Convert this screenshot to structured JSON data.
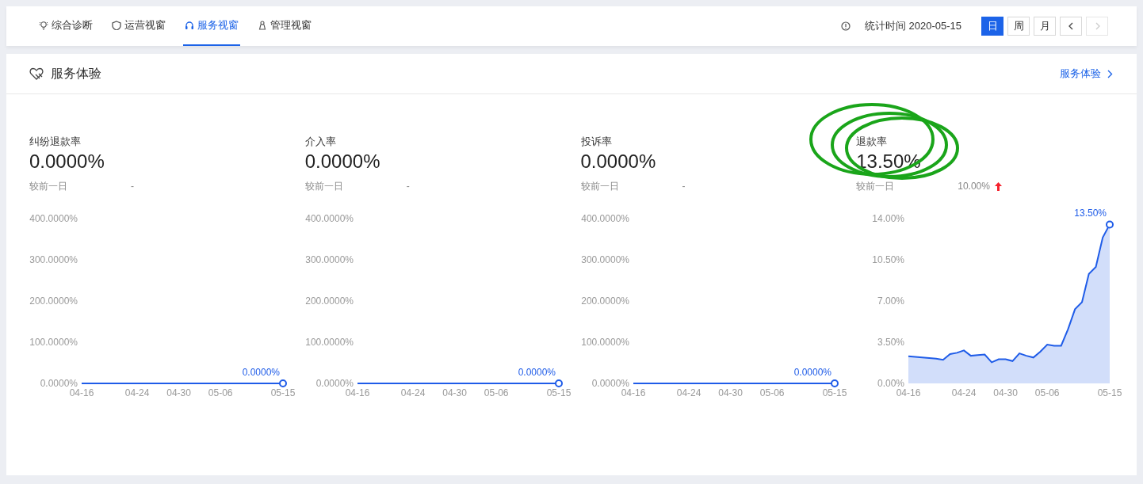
{
  "nav": {
    "tabs": [
      {
        "label": "综合诊断",
        "selected": false
      },
      {
        "label": "运营视窗",
        "selected": false
      },
      {
        "label": "服务视窗",
        "selected": true
      },
      {
        "label": "管理视窗",
        "selected": false
      }
    ],
    "stat_time": "统计时间 2020-05-15",
    "period_buttons": [
      {
        "label": "日",
        "selected": true
      },
      {
        "label": "周",
        "selected": false
      },
      {
        "label": "月",
        "selected": false
      }
    ],
    "pager": [
      {
        "kind": "prev",
        "disabled": false
      },
      {
        "kind": "next",
        "disabled": true
      }
    ]
  },
  "section": {
    "title": "服务体验",
    "link": "服务体验"
  },
  "metrics": [
    {
      "title": "纠纷退款率",
      "value": "0.0000%",
      "compare_label": "较前一日",
      "compare_value": "-",
      "chart_data": {
        "type": "line",
        "categories": [
          "04-16",
          null,
          null,
          null,
          null,
          null,
          null,
          null,
          "04-24",
          null,
          null,
          null,
          null,
          null,
          "04-30",
          null,
          null,
          null,
          null,
          null,
          "05-06",
          null,
          null,
          null,
          null,
          null,
          null,
          null,
          null,
          "05-15"
        ],
        "series": [
          {
            "color": "#1f5ce8",
            "values": [
              0,
              0,
              0,
              0,
              0,
              0,
              0,
              0,
              0,
              0,
              0,
              0,
              0,
              0,
              0,
              0,
              0,
              0,
              0,
              0,
              0,
              0,
              0,
              0,
              0,
              0,
              0,
              0,
              0,
              0
            ]
          }
        ],
        "ylim": [
          0,
          400
        ],
        "yticks": [
          {
            "value": 0,
            "label": "0.0000%"
          },
          {
            "value": 100,
            "label": "100.0000%"
          },
          {
            "value": 200,
            "label": "200.0000%"
          },
          {
            "value": 300,
            "label": "300.0000%"
          },
          {
            "value": 400,
            "label": "400.0000%"
          }
        ],
        "annotations": [
          "0.0000%"
        ]
      }
    },
    {
      "title": "介入率",
      "value": "0.0000%",
      "compare_label": "较前一日",
      "compare_value": "-",
      "chart_data": {
        "type": "line",
        "categories": [
          "04-16",
          null,
          null,
          null,
          null,
          null,
          null,
          null,
          "04-24",
          null,
          null,
          null,
          null,
          null,
          "04-30",
          null,
          null,
          null,
          null,
          null,
          "05-06",
          null,
          null,
          null,
          null,
          null,
          null,
          null,
          null,
          "05-15"
        ],
        "series": [
          {
            "color": "#1f5ce8",
            "values": [
              0,
              0,
              0,
              0,
              0,
              0,
              0,
              0,
              0,
              0,
              0,
              0,
              0,
              0,
              0,
              0,
              0,
              0,
              0,
              0,
              0,
              0,
              0,
              0,
              0,
              0,
              0,
              0,
              0,
              0
            ]
          }
        ],
        "ylim": [
          0,
          400
        ],
        "yticks": [
          {
            "value": 0,
            "label": "0.0000%"
          },
          {
            "value": 100,
            "label": "100.0000%"
          },
          {
            "value": 200,
            "label": "200.0000%"
          },
          {
            "value": 300,
            "label": "300.0000%"
          },
          {
            "value": 400,
            "label": "400.0000%"
          }
        ],
        "annotations": [
          "0.0000%"
        ]
      }
    },
    {
      "title": "投诉率",
      "value": "0.0000%",
      "compare_label": "较前一日",
      "compare_value": "-",
      "chart_data": {
        "type": "line",
        "categories": [
          "04-16",
          null,
          null,
          null,
          null,
          null,
          null,
          null,
          "04-24",
          null,
          null,
          null,
          null,
          null,
          "04-30",
          null,
          null,
          null,
          null,
          null,
          "05-06",
          null,
          null,
          null,
          null,
          null,
          null,
          null,
          null,
          "05-15"
        ],
        "series": [
          {
            "color": "#1f5ce8",
            "values": [
              0,
              0,
              0,
              0,
              0,
              0,
              0,
              0,
              0,
              0,
              0,
              0,
              0,
              0,
              0,
              0,
              0,
              0,
              0,
              0,
              0,
              0,
              0,
              0,
              0,
              0,
              0,
              0,
              0,
              0
            ]
          }
        ],
        "ylim": [
          0,
          400
        ],
        "yticks": [
          {
            "value": 0,
            "label": "0.0000%"
          },
          {
            "value": 100,
            "label": "100.0000%"
          },
          {
            "value": 200,
            "label": "200.0000%"
          },
          {
            "value": 300,
            "label": "300.0000%"
          },
          {
            "value": 400,
            "label": "400.0000%"
          }
        ],
        "annotations": [
          "0.0000%"
        ]
      }
    },
    {
      "title": "退款率",
      "value": "13.50%",
      "compare_label": "较前一日",
      "compare_value": "10.00%",
      "rising": true,
      "circled": true,
      "chart_data": {
        "type": "area",
        "categories": [
          "04-16",
          null,
          null,
          null,
          null,
          null,
          null,
          null,
          "04-24",
          null,
          null,
          null,
          null,
          null,
          "04-30",
          null,
          null,
          null,
          null,
          null,
          "05-06",
          null,
          null,
          null,
          null,
          null,
          null,
          null,
          null,
          "05-15"
        ],
        "series": [
          {
            "color": "#1f5ce8",
            "values": [
              2.3,
              2.25,
              2.2,
              2.15,
              2.1,
              2.0,
              2.5,
              2.6,
              2.8,
              2.35,
              2.4,
              2.45,
              1.8,
              2.05,
              2.05,
              1.9,
              2.55,
              2.35,
              2.2,
              2.7,
              3.3,
              3.2,
              3.2,
              4.6,
              6.3,
              6.9,
              9.3,
              9.9,
              12.4,
              13.5
            ]
          }
        ],
        "ylim": [
          0,
          14
        ],
        "yticks": [
          {
            "value": 0,
            "label": "0.00%"
          },
          {
            "value": 3.5,
            "label": "3.50%"
          },
          {
            "value": 7,
            "label": "7.00%"
          },
          {
            "value": 10.5,
            "label": "10.50%"
          },
          {
            "value": 14,
            "label": "14.00%"
          }
        ],
        "annotations": [
          "13.50%"
        ]
      }
    }
  ]
}
